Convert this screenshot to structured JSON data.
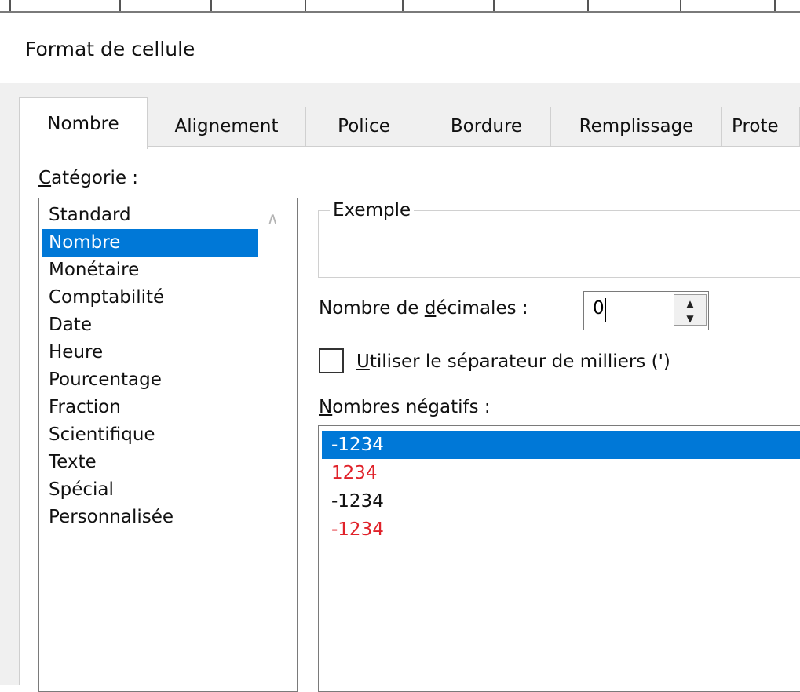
{
  "dialog": {
    "title": "Format de cellule"
  },
  "tabs": [
    {
      "label": "Nombre",
      "active": true
    },
    {
      "label": "Alignement"
    },
    {
      "label": "Police"
    },
    {
      "label": "Bordure"
    },
    {
      "label": "Remplissage"
    },
    {
      "label": "Prote"
    }
  ],
  "category": {
    "label_mnemonic": "C",
    "label_rest": "atégorie :",
    "items": [
      "Standard",
      "Nombre",
      "Monétaire",
      "Comptabilité",
      "Date",
      "Heure",
      "Pourcentage",
      "Fraction",
      "Scientifique",
      "Texte",
      "Spécial",
      "Personnalisée"
    ],
    "selected": "Nombre"
  },
  "example": {
    "label": "Exemple"
  },
  "decimals": {
    "label_before": "Nombre de ",
    "label_mnemonic": "d",
    "label_after": "écimales :",
    "value": "0"
  },
  "thousands": {
    "label_mnemonic": "U",
    "label_rest": "tiliser le séparateur de milliers (')",
    "checked": false
  },
  "negative": {
    "label_mnemonic": "N",
    "label_rest": "ombres négatifs :",
    "items": [
      {
        "text": "-1234",
        "color": "#ffffff",
        "selected": true
      },
      {
        "text": "1234",
        "color": "#e0222a"
      },
      {
        "text": "-1234",
        "color": "#111111"
      },
      {
        "text": "-1234",
        "color": "#e0222a"
      }
    ]
  },
  "colors": {
    "selection": "#0078d7",
    "negative_red": "#e0222a"
  }
}
